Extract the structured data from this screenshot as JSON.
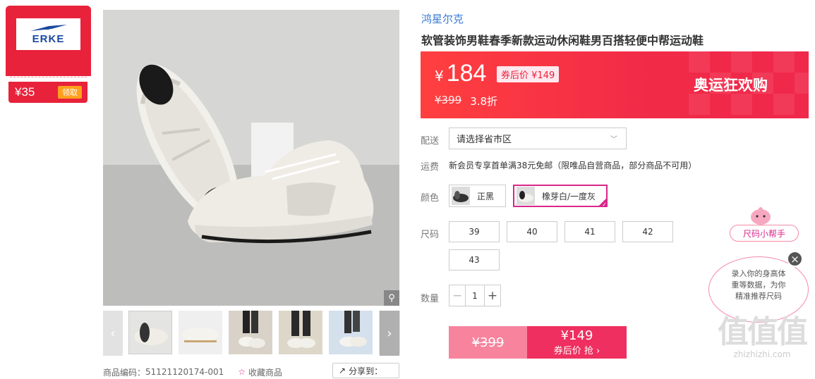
{
  "brand_card": {
    "logo_text": "ERKE",
    "coupon_amount": "¥35",
    "coupon_button": "领取"
  },
  "gallery": {
    "zoom_icon": "magnifier-icon",
    "left_arrow": "‹",
    "right_arrow": "›",
    "thumbnails": [
      "thumb-1",
      "thumb-2",
      "thumb-3",
      "thumb-4",
      "thumb-5",
      "thumb-6",
      "thumb-7"
    ]
  },
  "bottom": {
    "sku_label": "商品编码：",
    "sku": "51121120174-001",
    "favorite": "收藏商品",
    "share": "分享到："
  },
  "product": {
    "brand": "鸿星尔克",
    "title": "软管装饰男鞋春季新款运动休闲鞋男百搭轻便中帮运动鞋"
  },
  "price": {
    "yen": "¥",
    "current": "184",
    "after_coupon": "券后价 ¥149",
    "original": "¥399",
    "discount": "3.8折",
    "promo": "奥运狂欢购"
  },
  "delivery": {
    "label": "配送",
    "placeholder": "请选择省市区"
  },
  "freight": {
    "label": "运费",
    "text": "新会员专享首单满38元免邮（限唯品自营商品，部分商品不可用）"
  },
  "colors": {
    "label": "颜色",
    "options": [
      {
        "name": "正黑",
        "selected": false
      },
      {
        "name": "橡芽白/一度灰",
        "selected": true
      }
    ]
  },
  "sizes": {
    "label": "尺码",
    "options": [
      "39",
      "40",
      "41",
      "42",
      "43"
    ]
  },
  "quantity": {
    "label": "数量",
    "value": "1",
    "minus": "−",
    "plus": "+"
  },
  "buy": {
    "original": "¥399",
    "price": "¥149",
    "label": "券后价 抢 ›"
  },
  "size_helper": {
    "tag": "尺码小帮手",
    "bubble_lines": [
      "录入你的身高体",
      "重等数据，为你",
      "精准推荐尺码"
    ],
    "close": "×"
  },
  "watermark": {
    "big": "值值值",
    "url": "zhizhizhi.com"
  },
  "colors_theme": {
    "accent_red": "#e8223a",
    "buy_pink": "#ef2f5f",
    "selected_border": "#d9278a",
    "link_blue": "#3a7bd5"
  }
}
